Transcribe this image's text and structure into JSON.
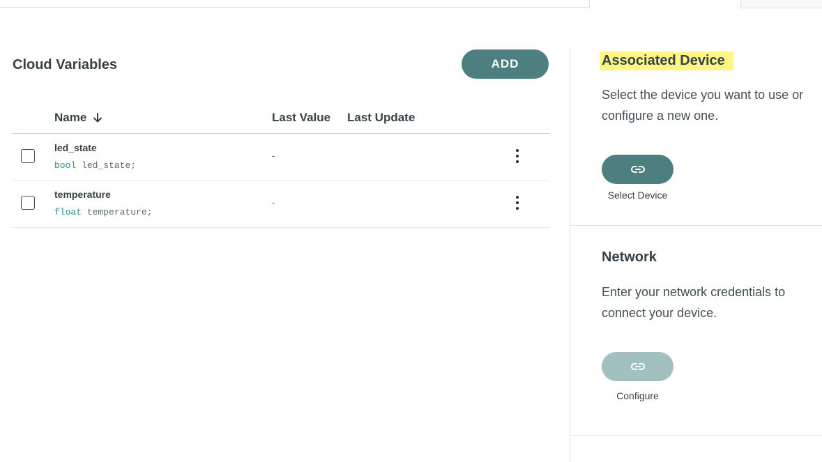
{
  "cloud_variables": {
    "title": "Cloud Variables",
    "add_label": "ADD",
    "columns": {
      "name": "Name",
      "last_value": "Last Value",
      "last_update": "Last Update"
    },
    "rows": [
      {
        "name": "led_state",
        "type": "bool",
        "decl_name": "led_state;",
        "last_value": "-"
      },
      {
        "name": "temperature",
        "type": "float",
        "decl_name": "temperature;",
        "last_value": "-"
      }
    ]
  },
  "associated_device": {
    "title": "Associated Device",
    "description": "Select the device you want to use or configure a new one.",
    "button_label": "Select Device"
  },
  "network": {
    "title": "Network",
    "description": "Enter your network credentials to connect your device.",
    "button_label": "Configure"
  },
  "icons": {
    "sort": "arrow-down-icon",
    "link": "link-icon",
    "menu": "more-vertical-icon"
  },
  "colors": {
    "primary": "#4e7f80",
    "primary_disabled": "#a3c0c1",
    "highlight": "#fff685"
  }
}
